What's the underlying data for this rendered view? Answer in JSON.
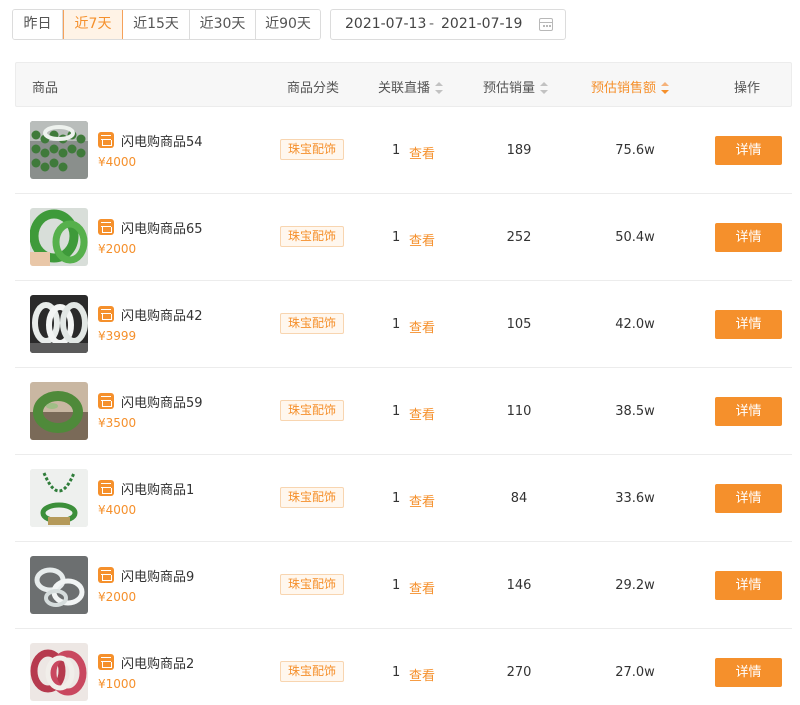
{
  "filters": {
    "ranges": [
      {
        "label": "昨日",
        "active": false
      },
      {
        "label": "近7天",
        "active": true
      },
      {
        "label": "近15天",
        "active": false
      },
      {
        "label": "近30天",
        "active": false
      },
      {
        "label": "近90天",
        "active": false
      }
    ],
    "date_start": "2021-07-13",
    "date_separator": "-",
    "date_end": "2021-07-19",
    "calendar_icon": "calendar-icon"
  },
  "table": {
    "headers": {
      "product": "商品",
      "category": "商品分类",
      "live": "关联直播",
      "sales": "预估销量",
      "amount": "预估销售额",
      "action": "操作"
    },
    "sort": {
      "active_column": "amount",
      "direction": "desc"
    },
    "rows": [
      {
        "name": "闪电购商品54",
        "price": "¥4000",
        "category": "珠宝配饰",
        "live_count": "1",
        "view_label": "查看",
        "sales": "189",
        "amount": "75.6w",
        "action": "详情",
        "thumb_style": "beads"
      },
      {
        "name": "闪电购商品65",
        "price": "¥2000",
        "category": "珠宝配饰",
        "live_count": "1",
        "view_label": "查看",
        "sales": "252",
        "amount": "50.4w",
        "action": "详情",
        "thumb_style": "green-bangle"
      },
      {
        "name": "闪电购商品42",
        "price": "¥3999",
        "category": "珠宝配饰",
        "live_count": "1",
        "view_label": "查看",
        "sales": "105",
        "amount": "42.0w",
        "action": "详情",
        "thumb_style": "white-bangles"
      },
      {
        "name": "闪电购商品59",
        "price": "¥3500",
        "category": "珠宝配饰",
        "live_count": "1",
        "view_label": "查看",
        "sales": "110",
        "amount": "38.5w",
        "action": "详情",
        "thumb_style": "hand-bangle"
      },
      {
        "name": "闪电购商品1",
        "price": "¥4000",
        "category": "珠宝配饰",
        "live_count": "1",
        "view_label": "查看",
        "sales": "84",
        "amount": "33.6w",
        "action": "详情",
        "thumb_style": "necklace"
      },
      {
        "name": "闪电购商品9",
        "price": "¥2000",
        "category": "珠宝配饰",
        "live_count": "1",
        "view_label": "查看",
        "sales": "146",
        "amount": "29.2w",
        "action": "详情",
        "thumb_style": "clear-bangles"
      },
      {
        "name": "闪电购商品2",
        "price": "¥1000",
        "category": "珠宝配饰",
        "live_count": "1",
        "view_label": "查看",
        "sales": "270",
        "amount": "27.0w",
        "action": "详情",
        "thumb_style": "pink-bangles"
      }
    ]
  },
  "colors": {
    "accent": "#f5902c",
    "tag_bg": "#fff7ee",
    "header_bg": "#f7f7f7"
  }
}
